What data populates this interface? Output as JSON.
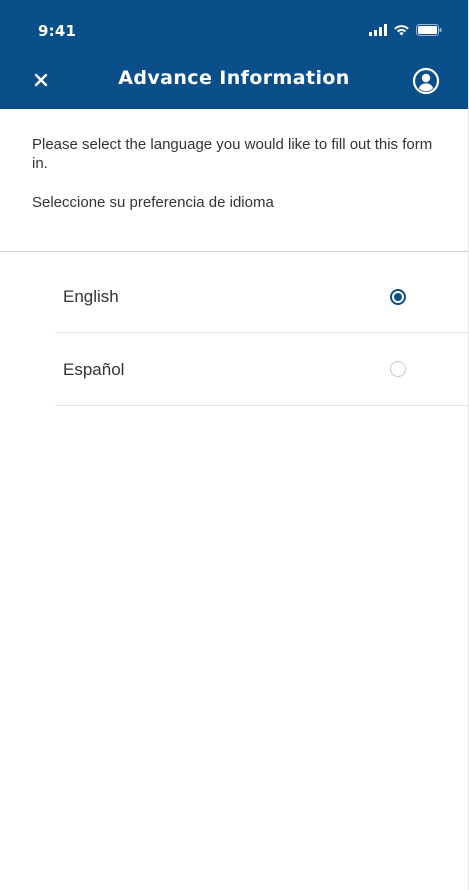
{
  "status_bar": {
    "time": "9:41",
    "icons": [
      "signal-icon",
      "wifi-icon",
      "battery-icon"
    ]
  },
  "nav": {
    "title": "Advance Information",
    "left_icon": "close-icon",
    "right_icon": "profile-icon"
  },
  "intro": {
    "english": "Please select the language you would like to fill out this form in.",
    "spanish": "Seleccione su preferencia de idioma"
  },
  "languages": [
    {
      "label": "English",
      "selected": true
    },
    {
      "label": "Español",
      "selected": false
    }
  ],
  "colors": {
    "header_bg": "#0b4f8a",
    "accent": "#0b4f8a",
    "text": "#333333",
    "divider": "#cfcfcf"
  }
}
